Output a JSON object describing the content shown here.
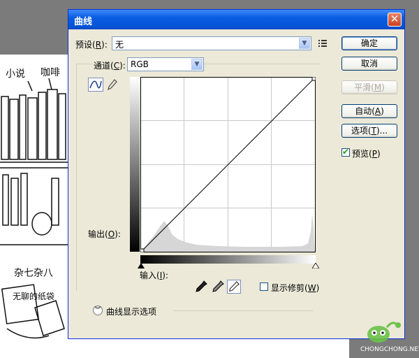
{
  "dialog": {
    "title": "曲线",
    "close": "✕",
    "preset": {
      "label": "预设(",
      "key": "R",
      "label_end": "):",
      "value": "无"
    },
    "channel": {
      "label": "通道(",
      "key": "C",
      "label_end": "):",
      "value": "RGB"
    },
    "output_label": {
      "text": "输出(",
      "key": "O",
      "end": "):"
    },
    "input_label": {
      "text": "输入(",
      "key": "I",
      "end": "):"
    },
    "show_clipping": {
      "text": "显示修剪(",
      "key": "W",
      "end": ")",
      "checked": false
    },
    "curve_options": "曲线显示选项",
    "buttons": {
      "ok": "确定",
      "cancel": "取消",
      "smooth": {
        "text": "平滑(",
        "key": "M",
        "end": ")"
      },
      "auto": {
        "text": "自动(",
        "key": "A",
        "end": ")"
      },
      "options": {
        "text": "选项(",
        "key": "T",
        "end": ")..."
      }
    },
    "preview": {
      "text": "预览(",
      "key": "P",
      "end": ")",
      "checked": true
    }
  },
  "background": {
    "label_novel": "小说",
    "label_coffee": "咖啡",
    "label_misc": "杂七杂八",
    "label_paper": "无聊的纸袋"
  },
  "watermark": "CHONGCHONG.NET",
  "colors": {
    "titlebar": "#0a5de3",
    "dialog_bg": "#ece9d8",
    "close": "#c9411e"
  }
}
